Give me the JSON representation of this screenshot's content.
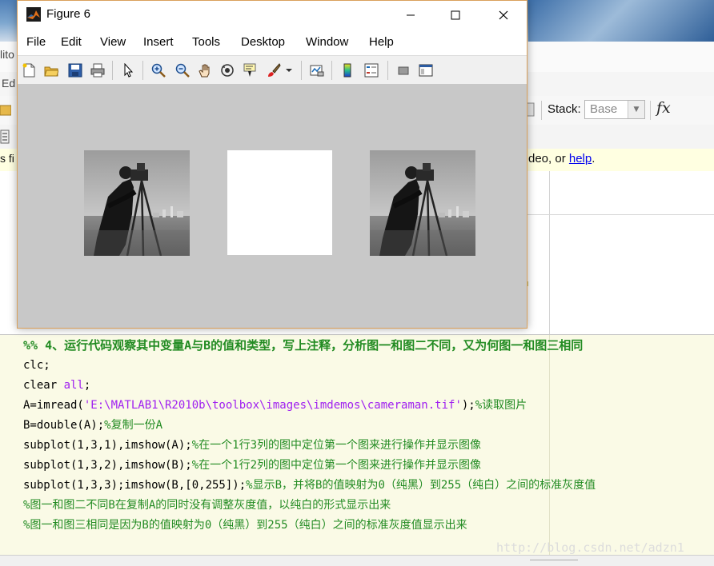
{
  "background": {
    "cut_menu_fragment": "lito",
    "cut_tab_fragment": "Ed",
    "cut_info_fragment": "s fi",
    "stack_label": "Stack:",
    "stack_value": "Base",
    "fx_label": "fx",
    "info_text_prefix": "deo, or ",
    "info_link": "help",
    "info_text_suffix": "."
  },
  "figure": {
    "title": "Figure 6",
    "menu": [
      "File",
      "Edit",
      "View",
      "Insert",
      "Tools",
      "Desktop",
      "Window",
      "Help"
    ],
    "toolbar_icons": [
      "new-figure-icon",
      "open-file-icon",
      "save-icon",
      "print-icon",
      "edit-plot-arrow-icon",
      "zoom-in-icon",
      "zoom-out-icon",
      "pan-hand-icon",
      "rotate-3d-icon",
      "data-cursor-icon",
      "brush-icon",
      "link-plot-icon",
      "colorbar-icon",
      "legend-icon",
      "hide-plot-tools-icon",
      "show-plot-tools-icon"
    ],
    "subplots": [
      {
        "content": "cameraman image"
      },
      {
        "content": "white image"
      },
      {
        "content": "cameraman image"
      }
    ]
  },
  "editor": {
    "lines": [
      {
        "segments": [
          {
            "t": "%% 4、运行代码观察其中变量A与B的值和类型，写上注释，分析图一和图二不同，又为何图一和图三相同",
            "c": "cell-title"
          }
        ]
      },
      {
        "segments": [
          {
            "t": "clc;",
            "c": ""
          }
        ]
      },
      {
        "segments": [
          {
            "t": "clear ",
            "c": ""
          },
          {
            "t": "all",
            "c": "str"
          },
          {
            "t": ";",
            "c": ""
          }
        ]
      },
      {
        "segments": [
          {
            "t": "A=imread(",
            "c": ""
          },
          {
            "t": "'E:\\MATLAB1\\R2010b\\toolbox\\images\\imdemos\\cameraman.tif'",
            "c": "str"
          },
          {
            "t": ");",
            "c": ""
          },
          {
            "t": "%读取图片",
            "c": "cmt"
          }
        ]
      },
      {
        "segments": [
          {
            "t": "B=double(A);",
            "c": ""
          },
          {
            "t": "%复制一份A",
            "c": "cmt"
          }
        ]
      },
      {
        "segments": [
          {
            "t": "subplot(1,3,1),imshow(A);",
            "c": ""
          },
          {
            "t": "%在一个1行3列的图中定位第一个图来进行操作并显示图像",
            "c": "cmt"
          }
        ]
      },
      {
        "segments": [
          {
            "t": "subplot(1,3,2),imshow(B);",
            "c": ""
          },
          {
            "t": "%在一个1行2列的图中定位第一个图来进行操作并显示图像",
            "c": "cmt"
          }
        ]
      },
      {
        "segments": [
          {
            "t": "subplot(1,3,3);imshow(B,[0,255]);",
            "c": ""
          },
          {
            "t": "%显示B，并将B的值映射为0（纯黑）到255（纯白）之间的标准灰度值",
            "c": "cmt"
          }
        ]
      },
      {
        "segments": [
          {
            "t": "%图一和图二不同B在复制A的同时没有调整灰度值，以纯白的形式显示出来",
            "c": "cmt"
          }
        ]
      },
      {
        "segments": [
          {
            "t": "%图一和图三相同是因为B的值映射为0（纯黑）到255（纯白）之间的标准灰度值显示出来",
            "c": "cmt"
          }
        ]
      }
    ]
  },
  "watermark": "http://blog.csdn.net/adzn1"
}
